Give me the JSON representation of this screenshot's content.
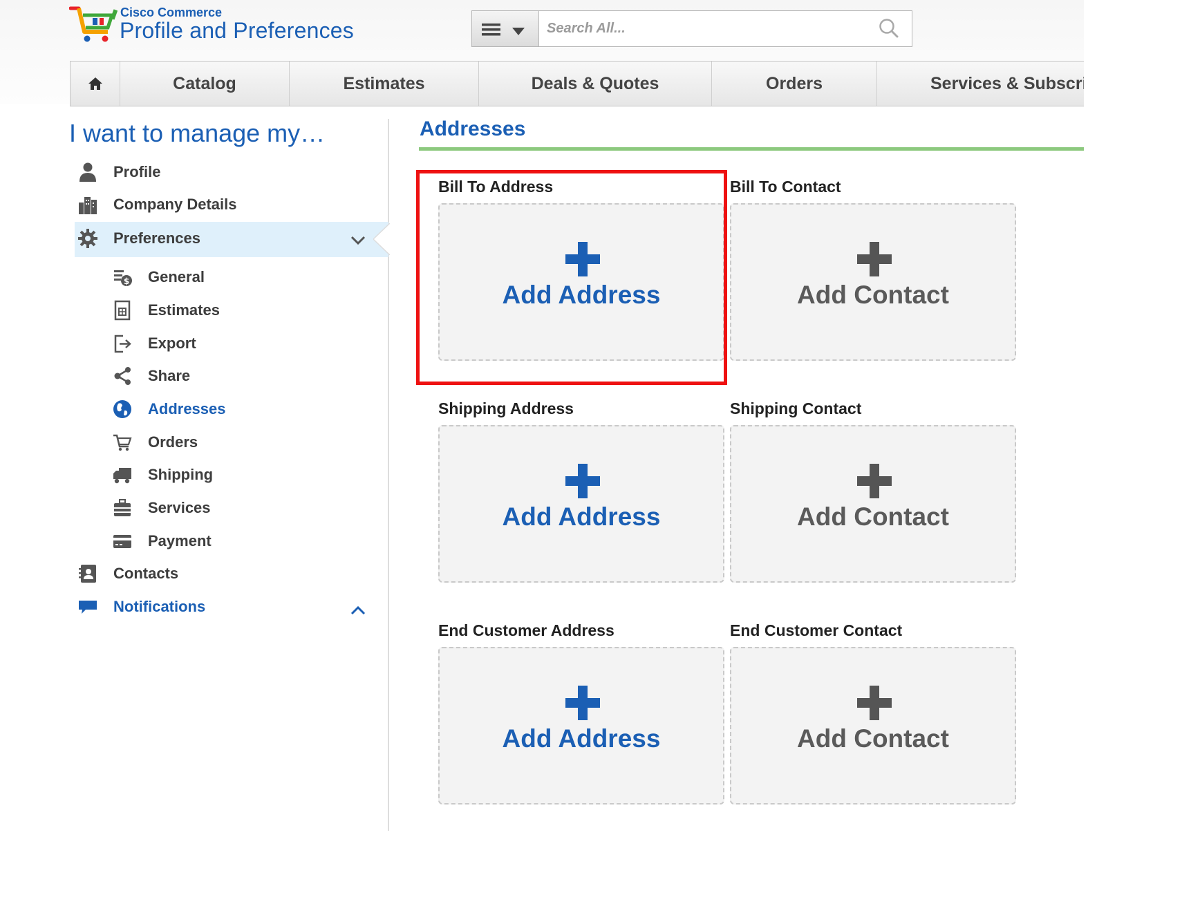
{
  "header": {
    "brand_small": "Cisco Commerce",
    "brand_title": "Profile and Preferences",
    "search_placeholder": "Search All..."
  },
  "nav": {
    "items": [
      "Catalog",
      "Estimates",
      "Deals & Quotes",
      "Orders",
      "Services & Subscri"
    ]
  },
  "sidebar": {
    "title": "I want to manage my…",
    "items": [
      {
        "label": "Profile",
        "icon": "person-icon"
      },
      {
        "label": "Company Details",
        "icon": "building-icon"
      },
      {
        "label": "Preferences",
        "icon": "gear-icon"
      },
      {
        "label": "Contacts",
        "icon": "contact-book-icon"
      },
      {
        "label": "Notifications",
        "icon": "chat-bubble-icon"
      }
    ],
    "sub_items": [
      {
        "label": "General",
        "icon": "general-settings-icon"
      },
      {
        "label": "Estimates",
        "icon": "estimates-sheet-icon"
      },
      {
        "label": "Export",
        "icon": "export-icon"
      },
      {
        "label": "Share",
        "icon": "share-icon"
      },
      {
        "label": "Addresses",
        "icon": "globe-icon"
      },
      {
        "label": "Orders",
        "icon": "cart-icon"
      },
      {
        "label": "Shipping",
        "icon": "truck-icon"
      },
      {
        "label": "Services",
        "icon": "briefcase-icon"
      },
      {
        "label": "Payment",
        "icon": "credit-card-icon"
      }
    ]
  },
  "main": {
    "title": "Addresses",
    "sections": [
      {
        "label": "Bill To Address",
        "action": "Add Address"
      },
      {
        "label": "Bill To Contact",
        "action": "Add Contact"
      },
      {
        "label": "Shipping Address",
        "action": "Add Address"
      },
      {
        "label": "Shipping Contact",
        "action": "Add Contact"
      },
      {
        "label": "End Customer Address",
        "action": "Add Address"
      },
      {
        "label": "End Customer Contact",
        "action": "Add Contact"
      }
    ]
  },
  "colors": {
    "brand_blue": "#1b5fb4",
    "rule_green": "#8cc97e",
    "highlight_red": "#ee1111",
    "selected_bg": "#dff0fb",
    "icon_gray": "#555555"
  }
}
